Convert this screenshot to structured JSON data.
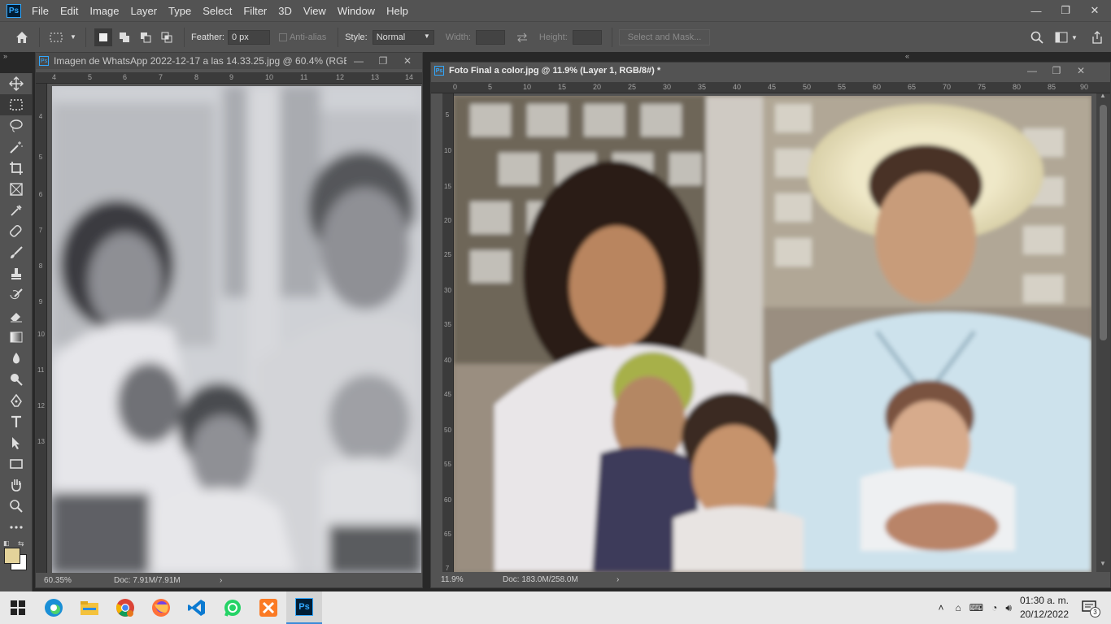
{
  "app": {
    "logo": "Ps"
  },
  "menu": [
    "File",
    "Edit",
    "Image",
    "Layer",
    "Type",
    "Select",
    "Filter",
    "3D",
    "View",
    "Window",
    "Help"
  ],
  "window_controls": {
    "minimize": "—",
    "restore": "❐",
    "close": "✕"
  },
  "options": {
    "feather_label": "Feather:",
    "feather_value": "0 px",
    "antialias_label": "Anti-alias",
    "style_label": "Style:",
    "style_value": "Normal",
    "width_label": "Width:",
    "height_label": "Height:",
    "select_mask_label": "Select and Mask..."
  },
  "doc1": {
    "title": "Imagen de WhatsApp 2022-12-17 a las 14.33.25.jpg @ 60.4% (RGB...",
    "zoom": "60.35%",
    "doc_size": "Doc: 7.91M/7.91M",
    "ruler_h": [
      "4",
      "5",
      "6",
      "7",
      "8",
      "9",
      "10",
      "11",
      "12",
      "13",
      "14"
    ],
    "ruler_v": [
      "4",
      "5",
      "6",
      "7",
      "8",
      "9",
      "10",
      "11",
      "12",
      "13"
    ]
  },
  "doc2": {
    "title": "Foto Final a color.jpg @ 11.9% (Layer 1, RGB/8#) *",
    "zoom": "11.9%",
    "doc_size": "Doc: 183.0M/258.0M",
    "ruler_h": [
      "0",
      "5",
      "10",
      "15",
      "20",
      "25",
      "30",
      "35",
      "40",
      "45",
      "50",
      "55",
      "60",
      "65",
      "70",
      "75",
      "80",
      "85",
      "90"
    ],
    "ruler_v": [
      "5",
      "10",
      "15",
      "20",
      "25",
      "30",
      "35",
      "40",
      "45",
      "50",
      "55",
      "60",
      "65",
      "7"
    ]
  },
  "colors": {
    "foreground": "#e4d39a",
    "background": "#ffffff",
    "accent": "#31a8ff"
  },
  "taskbar": {
    "apps": [
      "windows-start",
      "edge",
      "file-explorer",
      "chrome",
      "firefox",
      "vscode",
      "whatsapp",
      "xampp",
      "photoshop"
    ],
    "time": "01:30 a. m.",
    "date": "20/12/2022",
    "notifications": "3"
  }
}
